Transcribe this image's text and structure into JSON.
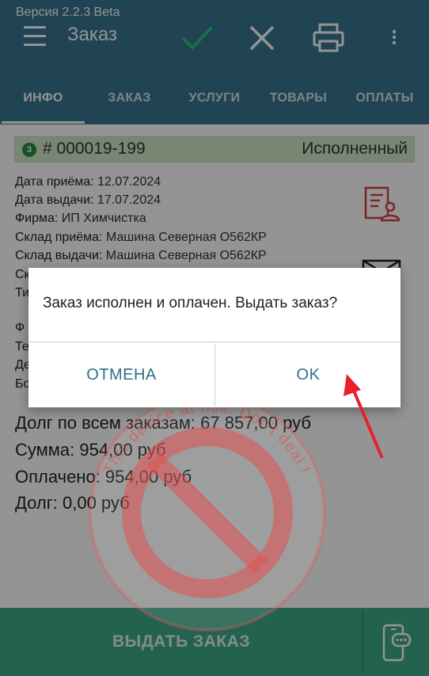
{
  "status_bar": {
    "version": "Версия 2.2.3 Beta"
  },
  "toolbar": {
    "title": "Заказ",
    "icons": [
      "menu-icon",
      "check-icon",
      "close-icon",
      "printer-icon",
      "more-vert-icon"
    ],
    "check_color": "#2ec27e"
  },
  "tabs": [
    {
      "label": "ИНФО",
      "active": true
    },
    {
      "label": "ЗАКАЗ"
    },
    {
      "label": "УСЛУГИ"
    },
    {
      "label": "ТОВАРЫ"
    },
    {
      "label": "ОПЛАТЫ"
    }
  ],
  "order": {
    "badge": "3",
    "number": "# 000019-199",
    "status": "Исполненный"
  },
  "details": [
    {
      "label": "Дата приёма:",
      "value": " 12.07.2024"
    },
    {
      "label": "Дата выдачи:",
      "value": " 17.07.2024"
    },
    {
      "label": "Фирма:",
      "value": " ИП Химчистка"
    },
    {
      "label": "Склад приёма:",
      "value": " Машина Северная О562КР"
    },
    {
      "label": "Склад выдачи:",
      "value": " Машина Северная О562КР"
    },
    {
      "label": "Ск",
      "value": ""
    },
    {
      "label": "Ти",
      "value": ""
    },
    {
      "label": "Ф",
      "value": ""
    },
    {
      "label": "Те",
      "value": ""
    },
    {
      "label": "Де",
      "value": ""
    },
    {
      "label": "Бо",
      "value": ""
    }
  ],
  "totals": {
    "debt_all": "Долг по всем заказам: 67 857,00 руб",
    "sum": "Сумма: 954,00 руб",
    "paid": "Оплачено: 954,00 руб",
    "debt": "Долг: 0,00 руб"
  },
  "bottom": {
    "issue_label": "ВЫДАТЬ ЗАКАЗ",
    "chat_icon": "chat-phone-icon"
  },
  "dialog": {
    "message": "Заказ исполнен и оплачен. Выдать заказ?",
    "cancel": "ОТМЕНА",
    "ok": "OK"
  },
  "watermark": {
    "text": "This device at risk. Don't deal !",
    "color": "#e05050"
  },
  "colors": {
    "header": "#37758f",
    "accent_green": "#3ea98a",
    "order_bar": "#cde8c9",
    "dialog_button": "#2f6f8c",
    "arrow": "#e8202a"
  }
}
